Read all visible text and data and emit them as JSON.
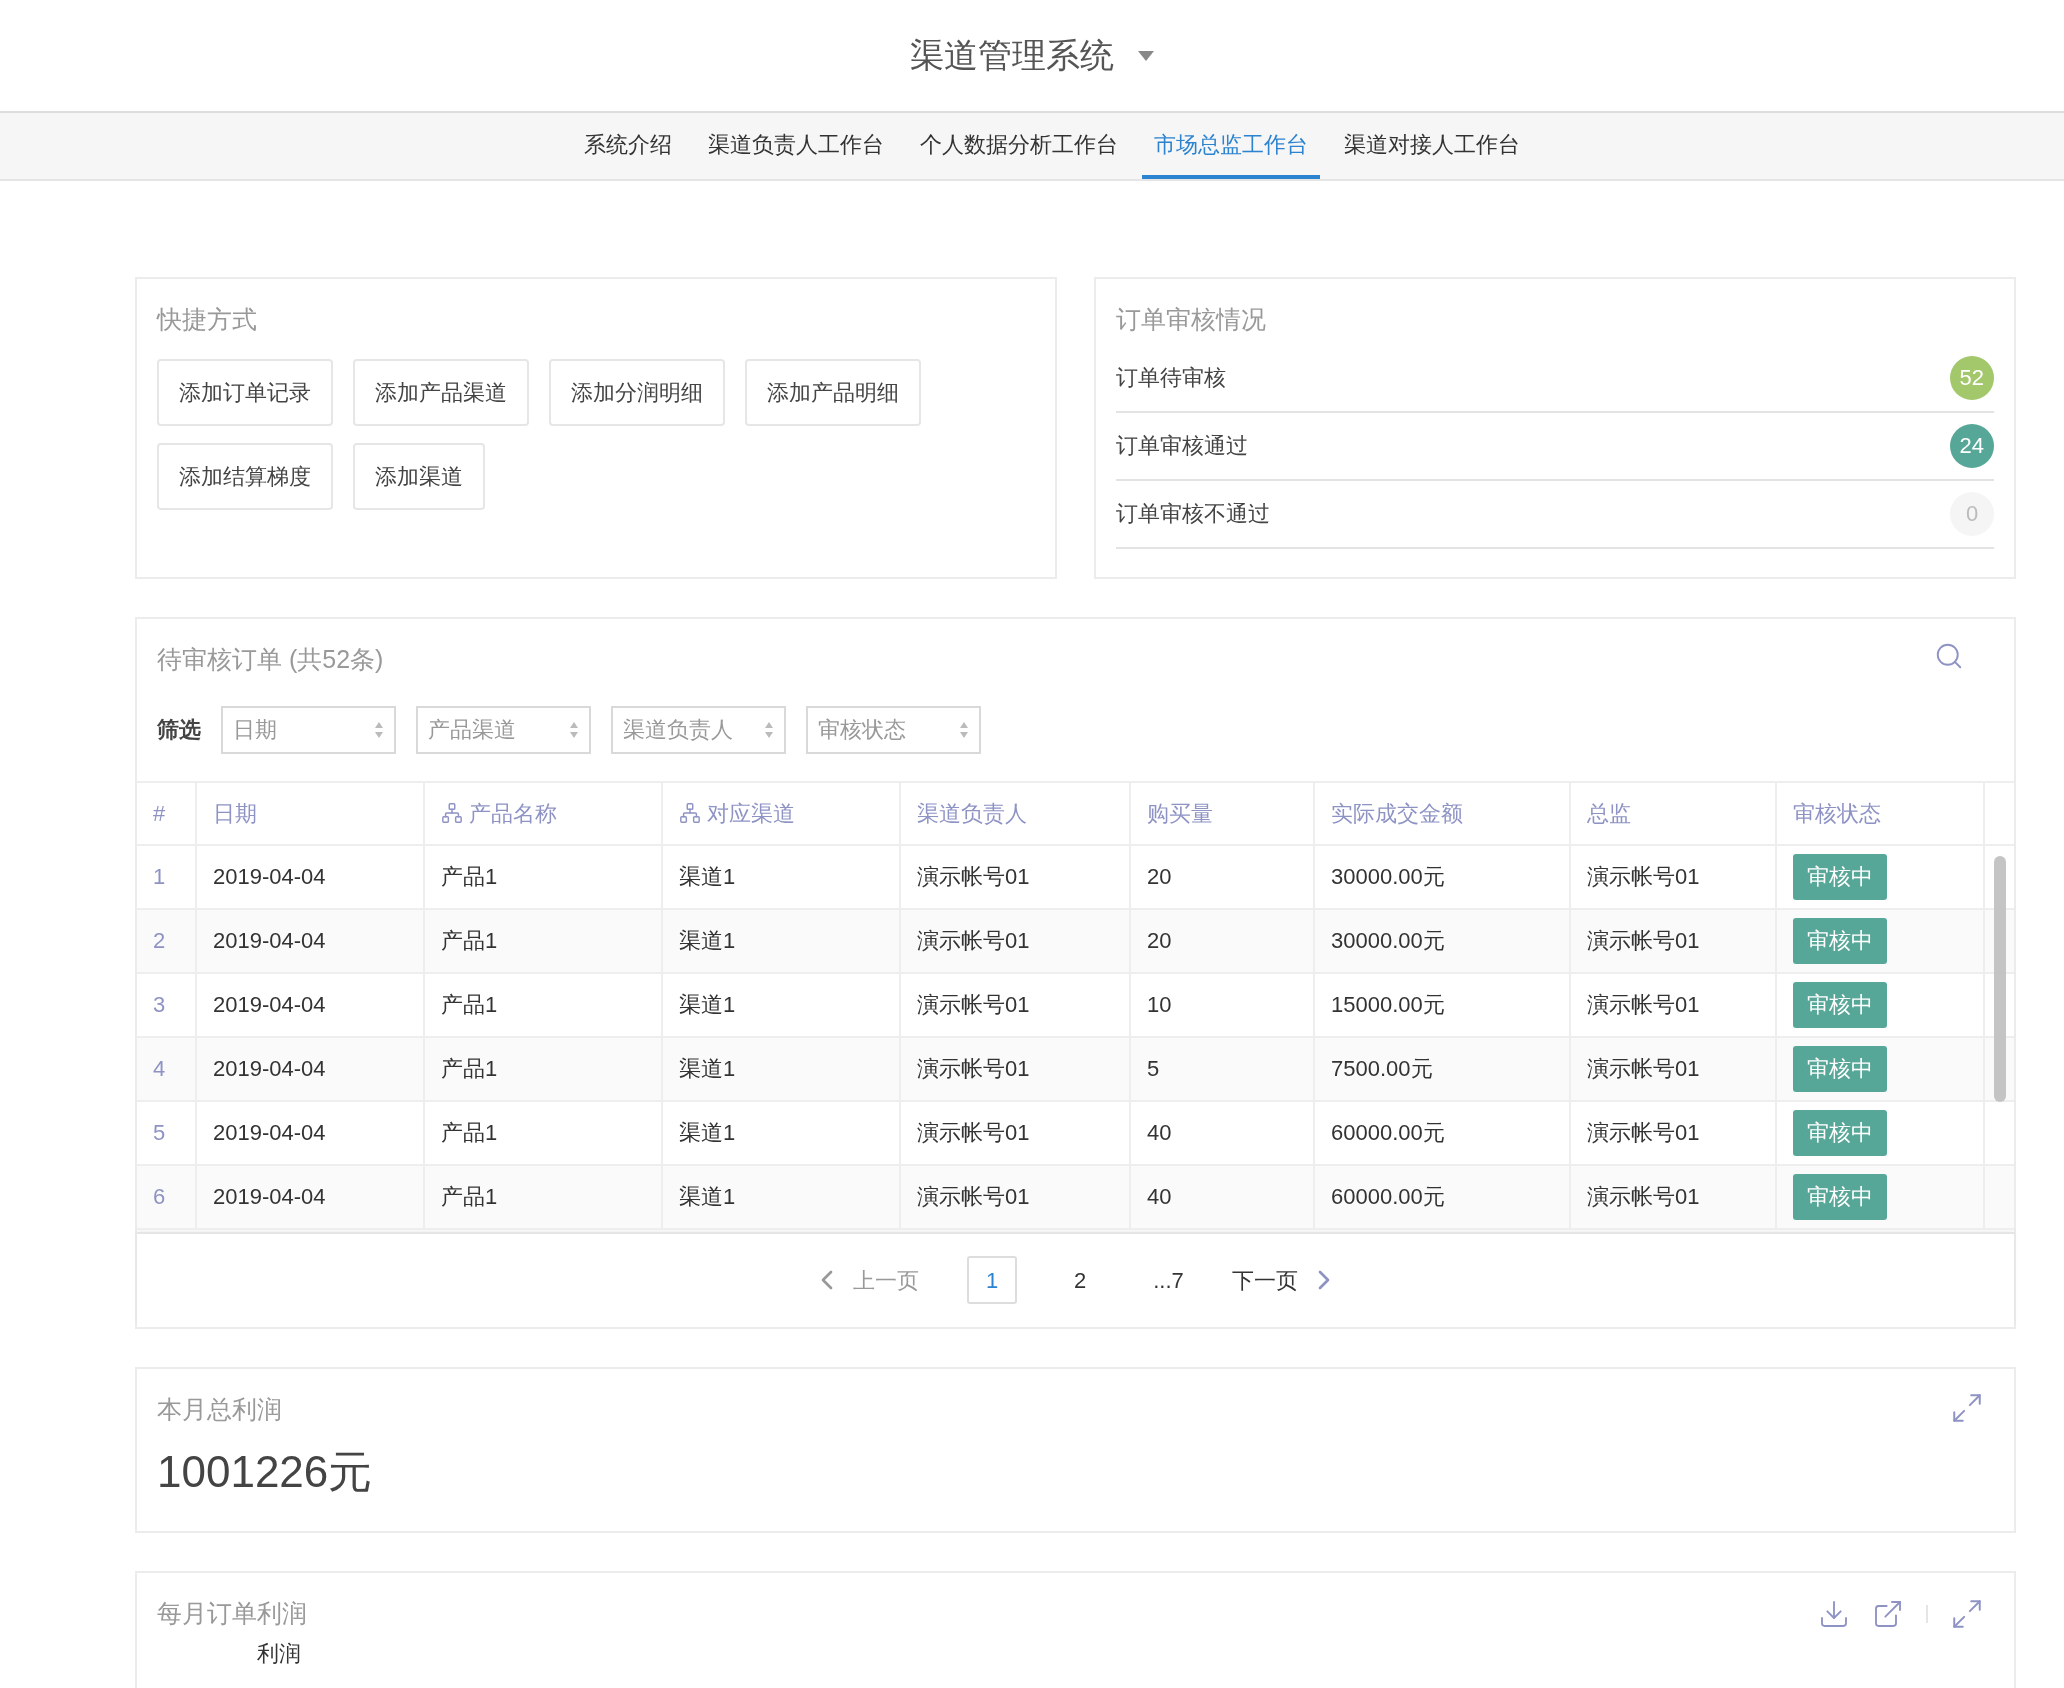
{
  "header": {
    "title": "渠道管理系统"
  },
  "tabs": [
    {
      "label": "系统介绍",
      "selected": false
    },
    {
      "label": "渠道负责人工作台",
      "selected": false
    },
    {
      "label": "个人数据分析工作台",
      "selected": false
    },
    {
      "label": "市场总监工作台",
      "selected": true
    },
    {
      "label": "渠道对接人工作台",
      "selected": false
    }
  ],
  "shortcuts": {
    "title": "快捷方式",
    "buttons": [
      "添加订单记录",
      "添加产品渠道",
      "添加分润明细",
      "添加产品明细",
      "添加结算梯度",
      "添加渠道"
    ]
  },
  "review_summary": {
    "title": "订单审核情况",
    "items": [
      {
        "label": "订单待审核",
        "count": "52",
        "color": "#a3c76b"
      },
      {
        "label": "订单审核通过",
        "count": "24",
        "color": "#56a797"
      },
      {
        "label": "订单审核不通过",
        "count": "0",
        "color": "#f5f5f5"
      }
    ]
  },
  "pending_orders": {
    "title": "待审核订单 (共52条)",
    "filter_label": "筛选",
    "filters": [
      {
        "placeholder": "日期"
      },
      {
        "placeholder": "产品渠道"
      },
      {
        "placeholder": "渠道负责人"
      },
      {
        "placeholder": "审核状态"
      }
    ],
    "columns": [
      {
        "label": "#",
        "tree_icon": false
      },
      {
        "label": "日期",
        "tree_icon": false
      },
      {
        "label": "产品名称",
        "tree_icon": true
      },
      {
        "label": "对应渠道",
        "tree_icon": true
      },
      {
        "label": "渠道负责人",
        "tree_icon": false
      },
      {
        "label": "购买量",
        "tree_icon": false
      },
      {
        "label": "实际成交金额",
        "tree_icon": false
      },
      {
        "label": "总监",
        "tree_icon": false
      },
      {
        "label": "审核状态",
        "tree_icon": false
      }
    ],
    "rows": [
      [
        "1",
        "2019-04-04",
        "产品1",
        "渠道1",
        "演示帐号01",
        "20",
        "30000.00元",
        "演示帐号01",
        "审核中"
      ],
      [
        "2",
        "2019-04-04",
        "产品1",
        "渠道1",
        "演示帐号01",
        "20",
        "30000.00元",
        "演示帐号01",
        "审核中"
      ],
      [
        "3",
        "2019-04-04",
        "产品1",
        "渠道1",
        "演示帐号01",
        "10",
        "15000.00元",
        "演示帐号01",
        "审核中"
      ],
      [
        "4",
        "2019-04-04",
        "产品1",
        "渠道1",
        "演示帐号01",
        "5",
        "7500.00元",
        "演示帐号01",
        "审核中"
      ],
      [
        "5",
        "2019-04-04",
        "产品1",
        "渠道1",
        "演示帐号01",
        "40",
        "60000.00元",
        "演示帐号01",
        "审核中"
      ],
      [
        "6",
        "2019-04-04",
        "产品1",
        "渠道1",
        "演示帐号01",
        "40",
        "60000.00元",
        "演示帐号01",
        "审核中"
      ]
    ],
    "pagination": {
      "prev": {
        "label": "上一页",
        "disabled": true
      },
      "pages": [
        {
          "label": "1",
          "selected": true
        },
        {
          "label": "2",
          "selected": false
        },
        {
          "label": "...7",
          "selected": false
        }
      ],
      "next": {
        "label": "下一页",
        "disabled": false
      }
    }
  },
  "monthly_profit_total": {
    "title": "本月总利润",
    "value": "1001226元"
  },
  "monthly_order_profit": {
    "title": "每月订单利润",
    "chart": {
      "ylabel": "利润"
    }
  }
}
